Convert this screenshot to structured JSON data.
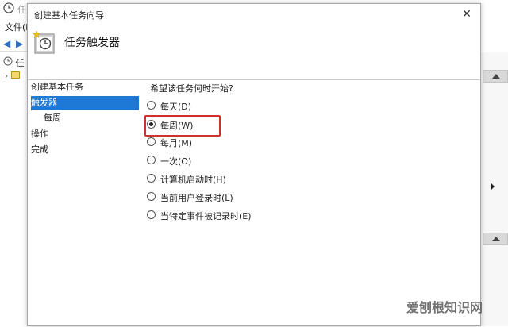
{
  "background_window": {
    "title": "任",
    "menu_file": "文件(F",
    "tree_item": "任",
    "tree_label": "任"
  },
  "dialog": {
    "title": "创建基本任务向导",
    "close_glyph": "✕",
    "header_title": "任务触发器"
  },
  "steps": [
    {
      "label": "创建基本任务"
    },
    {
      "label": "触发器"
    },
    {
      "label": "每周"
    },
    {
      "label": "操作"
    },
    {
      "label": "完成"
    }
  ],
  "question": "希望该任务何时开始?",
  "options": [
    {
      "label": "每天(D)",
      "checked": false
    },
    {
      "label": "每周(W)",
      "checked": true
    },
    {
      "label": "每月(M)",
      "checked": false
    },
    {
      "label": "一次(O)",
      "checked": false
    },
    {
      "label": "计算机启动时(H)",
      "checked": false
    },
    {
      "label": "当前用户登录时(L)",
      "checked": false
    },
    {
      "label": "当特定事件被记录时(E)",
      "checked": false
    }
  ],
  "watermark": "爱刨根知识网",
  "colors": {
    "selection": "#1e78d6",
    "highlight_border": "#d0312d"
  }
}
